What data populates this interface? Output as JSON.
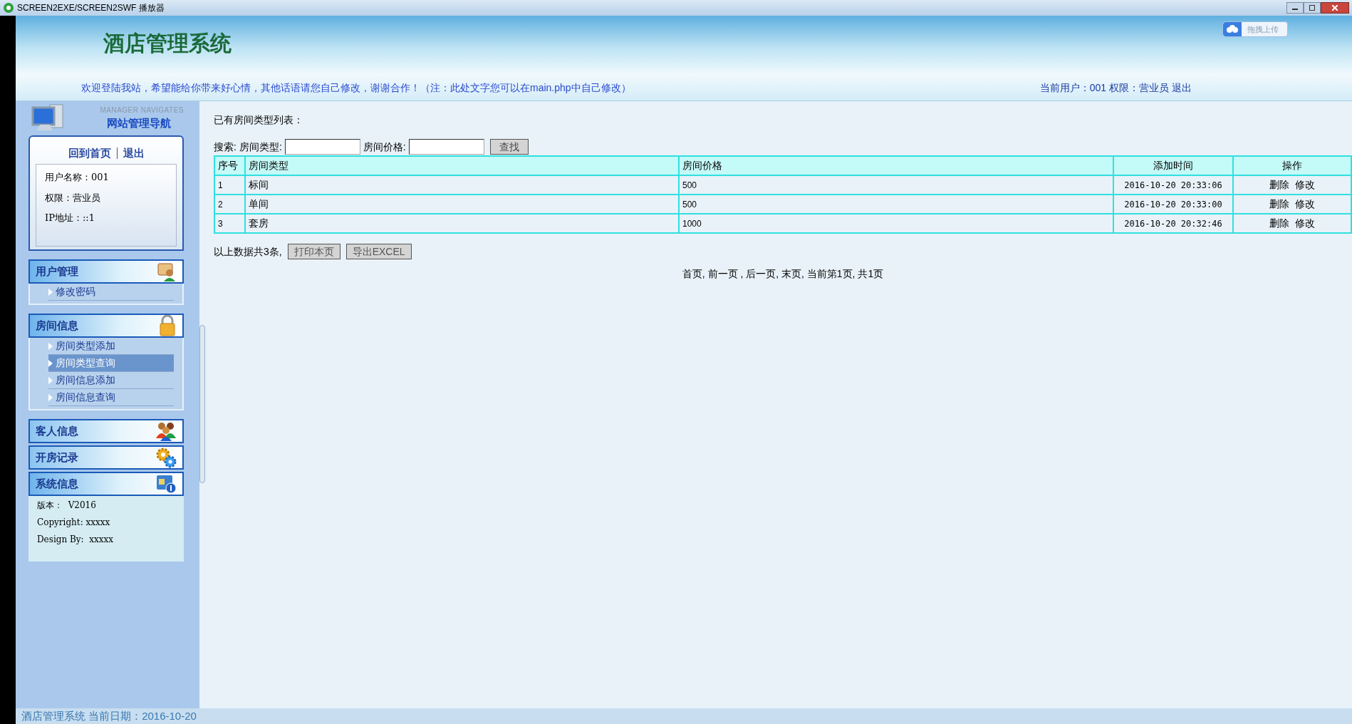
{
  "window": {
    "title": "SCREEN2EXE/SCREEN2SWF 播放器"
  },
  "header": {
    "title": "酒店管理系统",
    "upload_button": "拖拽上传"
  },
  "welcome": {
    "message": "欢迎登陆我站，希望能给你带来好心情，其他话语请您自己修改，谢谢合作！（注：此处文字您可以在main.php中自己修改）",
    "user_info": "当前用户：001 权限：营业员",
    "logout": "退出"
  },
  "sidebar": {
    "title_en": "MANAGER NAVIGATES",
    "title": "网站管理导航",
    "links": [
      "回到首页",
      "退出"
    ],
    "user_info": [
      "用户名称：001",
      "权限：营业员",
      "IP地址：::1"
    ],
    "menus": [
      {
        "title": "用户管理",
        "expanded": true,
        "items": [
          {
            "label": "修改密码",
            "selected": false
          }
        ]
      },
      {
        "title": "房间信息",
        "expanded": true,
        "items": [
          {
            "label": "房间类型添加",
            "selected": false
          },
          {
            "label": "房间类型查询",
            "selected": true
          },
          {
            "label": "房间信息添加",
            "selected": false
          },
          {
            "label": "房间信息查询",
            "selected": false
          }
        ]
      },
      {
        "title": "客人信息",
        "expanded": false
      },
      {
        "title": "开房记录",
        "expanded": false
      },
      {
        "title": "系统信息",
        "expanded": true
      }
    ],
    "system_info": [
      "版本：  V2016",
      "Copyright: xxxxx",
      "Design By:  xxxxx"
    ]
  },
  "content": {
    "heading": "已有房间类型列表：",
    "search": {
      "label": "搜索:",
      "fields": [
        {
          "label": "房间类型:"
        },
        {
          "label": "房间价格:"
        }
      ],
      "button": "查找"
    },
    "table": {
      "columns": [
        "序号",
        "房间类型",
        "房间价格",
        "添加时间",
        "操作"
      ],
      "rows": [
        {
          "cells": [
            "1",
            "标间",
            "500",
            "2016-10-20 20:33:06"
          ],
          "actions": [
            "删除",
            "修改"
          ]
        },
        {
          "cells": [
            "2",
            "单间",
            "500",
            "2016-10-20 20:33:00"
          ],
          "actions": [
            "删除",
            "修改"
          ]
        },
        {
          "cells": [
            "3",
            "套房",
            "1000",
            "2016-10-20 20:32:46"
          ],
          "actions": [
            "删除",
            "修改"
          ]
        }
      ]
    },
    "summary": "以上数据共3条,",
    "buttons": [
      "打印本页",
      "导出EXCEL"
    ],
    "pagination": "首页, 前一页 , 后一页, 末页, 当前第1页, 共1页"
  },
  "footer": "酒店管理系统 当前日期：2016-10-20"
}
